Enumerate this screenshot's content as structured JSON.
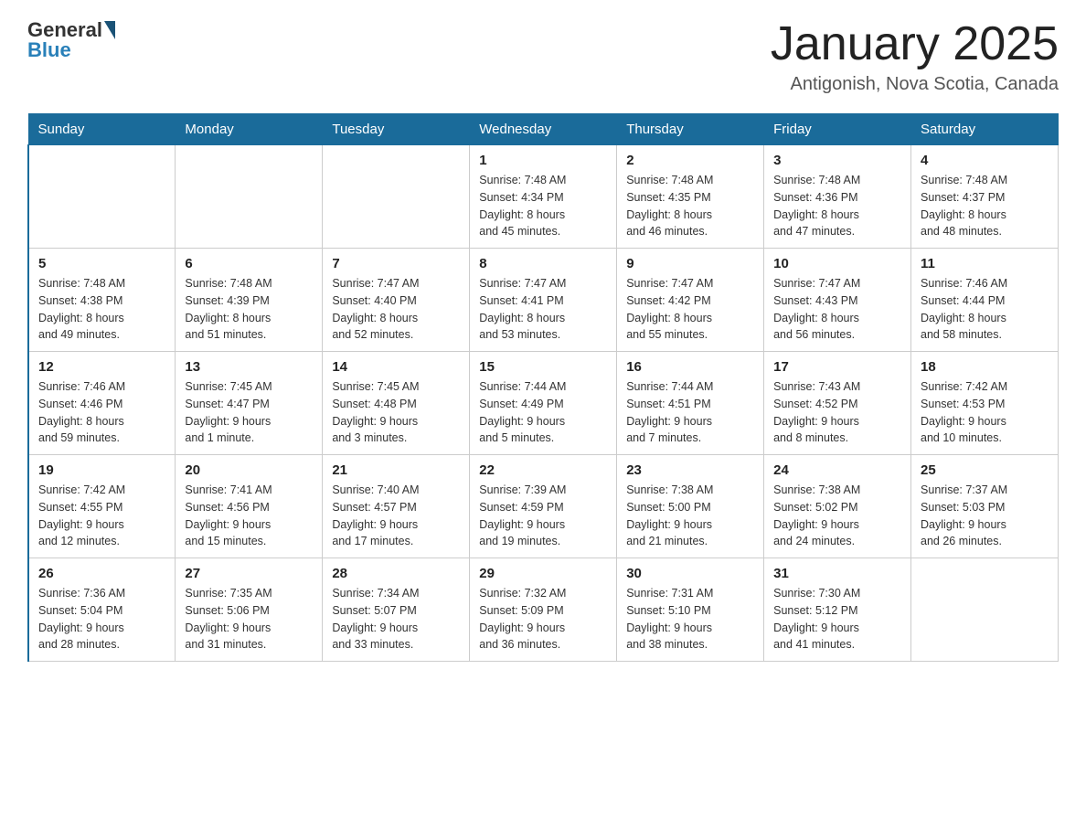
{
  "header": {
    "logo_general": "General",
    "logo_blue": "Blue",
    "month_title": "January 2025",
    "location": "Antigonish, Nova Scotia, Canada"
  },
  "weekdays": [
    "Sunday",
    "Monday",
    "Tuesday",
    "Wednesday",
    "Thursday",
    "Friday",
    "Saturday"
  ],
  "weeks": [
    [
      {
        "day": "",
        "info": ""
      },
      {
        "day": "",
        "info": ""
      },
      {
        "day": "",
        "info": ""
      },
      {
        "day": "1",
        "info": "Sunrise: 7:48 AM\nSunset: 4:34 PM\nDaylight: 8 hours\nand 45 minutes."
      },
      {
        "day": "2",
        "info": "Sunrise: 7:48 AM\nSunset: 4:35 PM\nDaylight: 8 hours\nand 46 minutes."
      },
      {
        "day": "3",
        "info": "Sunrise: 7:48 AM\nSunset: 4:36 PM\nDaylight: 8 hours\nand 47 minutes."
      },
      {
        "day": "4",
        "info": "Sunrise: 7:48 AM\nSunset: 4:37 PM\nDaylight: 8 hours\nand 48 minutes."
      }
    ],
    [
      {
        "day": "5",
        "info": "Sunrise: 7:48 AM\nSunset: 4:38 PM\nDaylight: 8 hours\nand 49 minutes."
      },
      {
        "day": "6",
        "info": "Sunrise: 7:48 AM\nSunset: 4:39 PM\nDaylight: 8 hours\nand 51 minutes."
      },
      {
        "day": "7",
        "info": "Sunrise: 7:47 AM\nSunset: 4:40 PM\nDaylight: 8 hours\nand 52 minutes."
      },
      {
        "day": "8",
        "info": "Sunrise: 7:47 AM\nSunset: 4:41 PM\nDaylight: 8 hours\nand 53 minutes."
      },
      {
        "day": "9",
        "info": "Sunrise: 7:47 AM\nSunset: 4:42 PM\nDaylight: 8 hours\nand 55 minutes."
      },
      {
        "day": "10",
        "info": "Sunrise: 7:47 AM\nSunset: 4:43 PM\nDaylight: 8 hours\nand 56 minutes."
      },
      {
        "day": "11",
        "info": "Sunrise: 7:46 AM\nSunset: 4:44 PM\nDaylight: 8 hours\nand 58 minutes."
      }
    ],
    [
      {
        "day": "12",
        "info": "Sunrise: 7:46 AM\nSunset: 4:46 PM\nDaylight: 8 hours\nand 59 minutes."
      },
      {
        "day": "13",
        "info": "Sunrise: 7:45 AM\nSunset: 4:47 PM\nDaylight: 9 hours\nand 1 minute."
      },
      {
        "day": "14",
        "info": "Sunrise: 7:45 AM\nSunset: 4:48 PM\nDaylight: 9 hours\nand 3 minutes."
      },
      {
        "day": "15",
        "info": "Sunrise: 7:44 AM\nSunset: 4:49 PM\nDaylight: 9 hours\nand 5 minutes."
      },
      {
        "day": "16",
        "info": "Sunrise: 7:44 AM\nSunset: 4:51 PM\nDaylight: 9 hours\nand 7 minutes."
      },
      {
        "day": "17",
        "info": "Sunrise: 7:43 AM\nSunset: 4:52 PM\nDaylight: 9 hours\nand 8 minutes."
      },
      {
        "day": "18",
        "info": "Sunrise: 7:42 AM\nSunset: 4:53 PM\nDaylight: 9 hours\nand 10 minutes."
      }
    ],
    [
      {
        "day": "19",
        "info": "Sunrise: 7:42 AM\nSunset: 4:55 PM\nDaylight: 9 hours\nand 12 minutes."
      },
      {
        "day": "20",
        "info": "Sunrise: 7:41 AM\nSunset: 4:56 PM\nDaylight: 9 hours\nand 15 minutes."
      },
      {
        "day": "21",
        "info": "Sunrise: 7:40 AM\nSunset: 4:57 PM\nDaylight: 9 hours\nand 17 minutes."
      },
      {
        "day": "22",
        "info": "Sunrise: 7:39 AM\nSunset: 4:59 PM\nDaylight: 9 hours\nand 19 minutes."
      },
      {
        "day": "23",
        "info": "Sunrise: 7:38 AM\nSunset: 5:00 PM\nDaylight: 9 hours\nand 21 minutes."
      },
      {
        "day": "24",
        "info": "Sunrise: 7:38 AM\nSunset: 5:02 PM\nDaylight: 9 hours\nand 24 minutes."
      },
      {
        "day": "25",
        "info": "Sunrise: 7:37 AM\nSunset: 5:03 PM\nDaylight: 9 hours\nand 26 minutes."
      }
    ],
    [
      {
        "day": "26",
        "info": "Sunrise: 7:36 AM\nSunset: 5:04 PM\nDaylight: 9 hours\nand 28 minutes."
      },
      {
        "day": "27",
        "info": "Sunrise: 7:35 AM\nSunset: 5:06 PM\nDaylight: 9 hours\nand 31 minutes."
      },
      {
        "day": "28",
        "info": "Sunrise: 7:34 AM\nSunset: 5:07 PM\nDaylight: 9 hours\nand 33 minutes."
      },
      {
        "day": "29",
        "info": "Sunrise: 7:32 AM\nSunset: 5:09 PM\nDaylight: 9 hours\nand 36 minutes."
      },
      {
        "day": "30",
        "info": "Sunrise: 7:31 AM\nSunset: 5:10 PM\nDaylight: 9 hours\nand 38 minutes."
      },
      {
        "day": "31",
        "info": "Sunrise: 7:30 AM\nSunset: 5:12 PM\nDaylight: 9 hours\nand 41 minutes."
      },
      {
        "day": "",
        "info": ""
      }
    ]
  ]
}
